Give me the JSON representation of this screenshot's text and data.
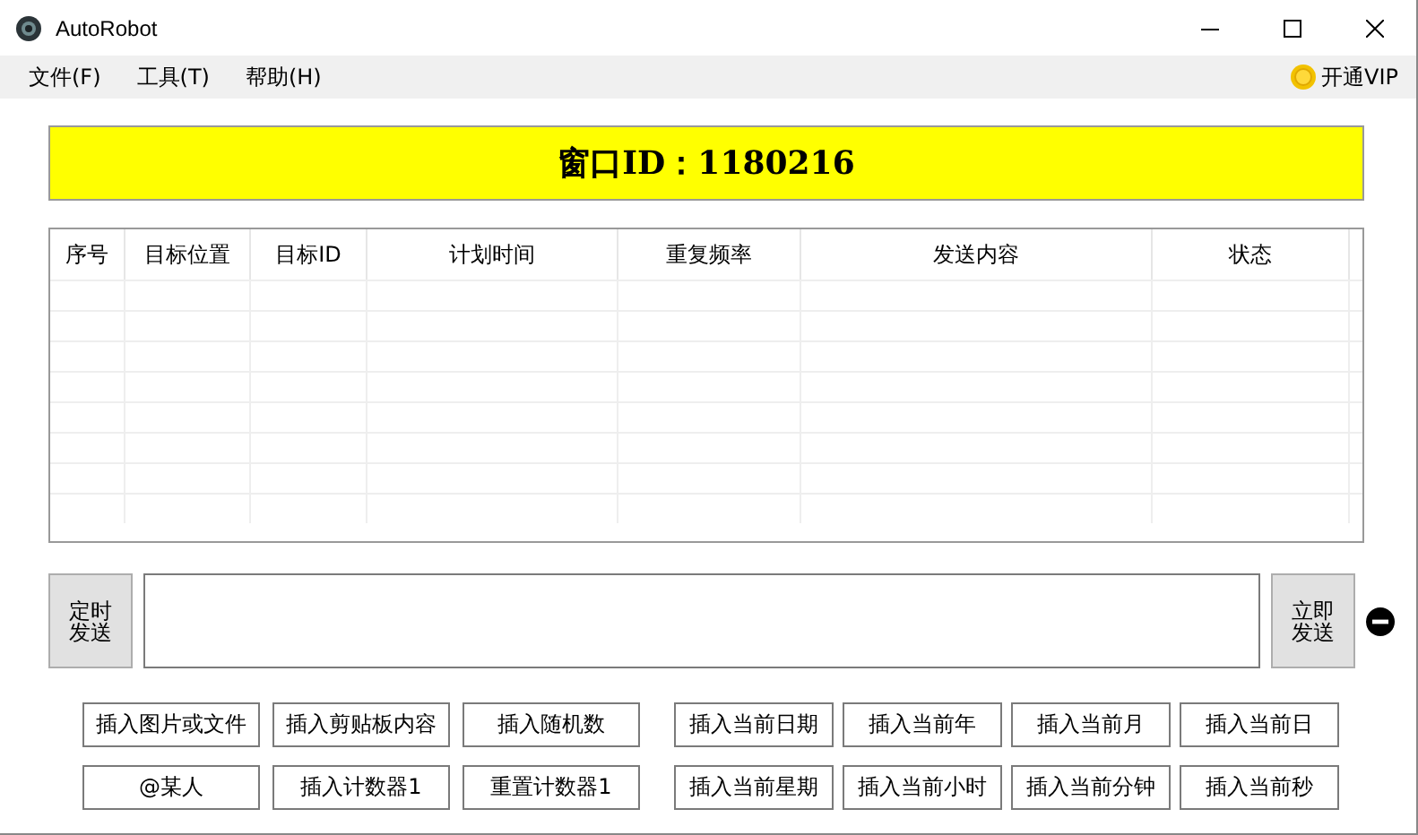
{
  "window": {
    "title": "AutoRobot"
  },
  "menu": [
    {
      "label": "文件(F)"
    },
    {
      "label": "工具(T)"
    },
    {
      "label": "帮助(H)"
    }
  ],
  "vip": {
    "label": "开通VIP"
  },
  "banner": {
    "text": "窗口ID：1180216"
  },
  "table": {
    "columns": [
      "序号",
      "目标位置",
      "目标ID",
      "计划时间",
      "重复频率",
      "发送内容",
      "状态"
    ]
  },
  "schedule_button": {
    "label": "定时发送"
  },
  "send_button": {
    "label": "立即发送"
  },
  "insert_groups": [
    {
      "buttons": [
        "插入图片或文件",
        "插入剪贴板内容",
        "插入随机数",
        "@某人",
        "插入计数器1",
        "重置计数器1"
      ]
    },
    {
      "buttons": [
        "插入当前日期",
        "插入当前年",
        "插入当前月",
        "插入当前日",
        "插入当前星期",
        "插入当前小时",
        "插入当前分钟",
        "插入当前秒"
      ]
    }
  ]
}
